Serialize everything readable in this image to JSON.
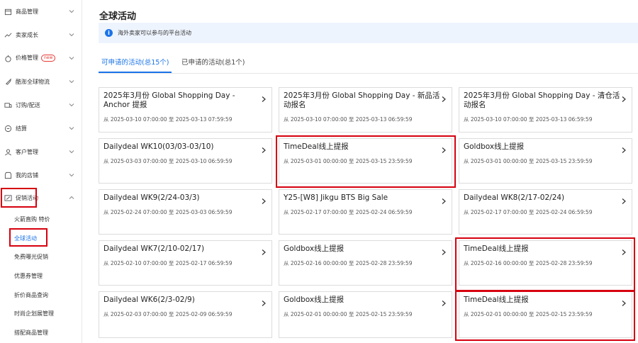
{
  "sidebar": {
    "items": [
      {
        "label": "商品管理",
        "icon": "box-icon"
      },
      {
        "label": "卖家成长",
        "icon": "growth-icon"
      },
      {
        "label": "价格管理",
        "icon": "price-icon",
        "badge": "new"
      },
      {
        "label": "酷澎全球物流",
        "icon": "rocket-icon"
      },
      {
        "label": "订购/配送",
        "icon": "delivery-icon"
      },
      {
        "label": "结算",
        "icon": "settlement-icon"
      },
      {
        "label": "客户管理",
        "icon": "customer-icon"
      },
      {
        "label": "我的店铺",
        "icon": "store-icon"
      },
      {
        "label": "促销活动",
        "icon": "promotion-icon"
      }
    ],
    "sub_items": [
      "火箭直购 特价",
      "全球活动",
      "免费曝光促销",
      "优惠券管理",
      "折价商品查询",
      "时尚企划展管理",
      "搭配商品管理"
    ]
  },
  "header": {
    "title": "全球活动"
  },
  "info": {
    "text": "海外卖家可以参与的平台活动"
  },
  "tabs": [
    {
      "label": "可申请的活动(总15个)"
    },
    {
      "label": "已申请的活动(总1个)"
    }
  ],
  "cards": [
    {
      "title": "2025年3月份 Global Shopping Day - Anchor 提报",
      "date": "从 2025-03-10 07:00:00 至 2025-03-13 07:59:59"
    },
    {
      "title": "2025年3月份 Global Shopping Day - 新品活动报名",
      "date": "从 2025-03-10 07:00:00 至 2025-03-13 06:59:59"
    },
    {
      "title": "2025年3月份 Global Shopping Day - 清仓活动报名",
      "date": "从 2025-03-10 07:00:00 至 2025-03-13 06:59:59"
    },
    {
      "title": "Dailydeal WK10(03/03-03/10)",
      "date": "从 2025-03-03 07:00:00 至 2025-03-10 06:59:59"
    },
    {
      "title": "TimeDeal线上提报",
      "date": "从 2025-03-01 00:00:00 至 2025-03-15 23:59:59"
    },
    {
      "title": "Goldbox线上提报",
      "date": "从 2025-03-01 00:00:00 至 2025-03-15 23:59:59"
    },
    {
      "title": "Dailydeal WK9(2/24-03/3)",
      "date": "从 2025-02-24 07:00:00 至 2025-03-03 06:59:59"
    },
    {
      "title": "Y25-[W8] Jikgu BTS Big Sale",
      "date": "从 2025-02-17 07:00:00 至 2025-02-24 06:59:59"
    },
    {
      "title": "Dailydeal WK8(2/17-02/24)",
      "date": "从 2025-02-17 07:00:00 至 2025-02-24 06:59:59"
    },
    {
      "title": "Dailydeal WK7(2/10-02/17)",
      "date": "从 2025-02-10 07:00:00 至 2025-02-17 06:59:59"
    },
    {
      "title": "Goldbox线上提报",
      "date": "从 2025-02-16 00:00:00 至 2025-02-28 23:59:59"
    },
    {
      "title": "TimeDeal线上提报",
      "date": "从 2025-02-16 00:00:00 至 2025-02-28 23:59:59"
    },
    {
      "title": "Dailydeal WK6(2/3-02/9)",
      "date": "从 2025-02-03 07:00:00 至 2025-02-09 06:59:59"
    },
    {
      "title": "Goldbox线上提报",
      "date": "从 2025-02-01 00:00:00 至 2025-02-15 23:59:59"
    },
    {
      "title": "TimeDeal线上提报",
      "date": "从 2025-02-01 00:00:00 至 2025-02-15 23:59:59"
    }
  ],
  "colors": {
    "accent": "#1a73e8",
    "highlight": "#d6000f",
    "badge": "#e53935"
  }
}
